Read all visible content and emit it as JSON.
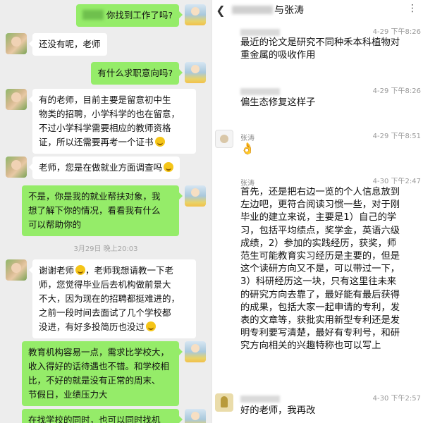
{
  "left_chat": {
    "messages": [
      {
        "from": "me",
        "text": "你找到工作了吗?"
      },
      {
        "from": "other",
        "text": "还没有呢，老师"
      },
      {
        "from": "me",
        "text": "有什么求职意向吗?"
      },
      {
        "from": "other",
        "lines": [
          "有的老师，目前主要是留意初中生",
          "物类的招聘，小学科学的也在留意，",
          "不过小学科学需要相应的教师资格",
          "证，所以还需要再考一个证书"
        ]
      },
      {
        "from": "other",
        "text": "老师，您是在做就业方面调查吗"
      },
      {
        "from": "me",
        "lines": [
          "不是，你是我的就业帮扶对象，我",
          "想了解下你的情况，看看我有什么",
          "可以帮助你的"
        ]
      },
      {
        "from": "other",
        "lines": [
          "谢谢老师",
          "，老师我想请教一下老",
          "师，您觉得毕业后去机构做前景大",
          "不大，因为现在的招聘都挺难进的，",
          "之前一段时间去面试了几个学校都",
          "没进，有好多投简历也没过"
        ]
      },
      {
        "from": "me",
        "lines": [
          "教育机构容易一点，需求比学校大，",
          "收入得好的话待遇也不错。和学校相",
          "比，不好的就是没有正常的周末、",
          "节假日，业绩压力大"
        ]
      },
      {
        "from": "me",
        "text": "在找学校的同时，也可以同时找机"
      }
    ],
    "timestamp": "3月29日 晚上20:03"
  },
  "right_chat": {
    "title_suffix": "与张涛",
    "back_icon": "chevron-left-icon",
    "more_icon": "more-icon",
    "messages": [
      {
        "sender": "",
        "time": "4-29 下午8:26",
        "lines": [
          "最近的论文是研究不同种禾本科植物对",
          "重金属的吸收作用"
        ]
      },
      {
        "sender": "",
        "time": "4-29 下午8:26",
        "lines": [
          "偏生态修复这样子"
        ]
      },
      {
        "sender": "张涛",
        "time": "4-29 下午8:51",
        "emoji": "ok-hand"
      },
      {
        "sender": "张涛",
        "time": "4-30 下午2:47",
        "lines": [
          "首先，还是把右边一览的个人信息放到",
          "左边吧，更符合阅读习惯一些，对于刚",
          "毕业的建立来说，主要是1）自己的学",
          "习，包括平均绩点，奖学金，英语六级",
          "成绩，2）参加的实践经历，获奖，师",
          "范生可能教育实习经历是主要的，但是",
          "这个读研方向又不是，可以带过一下，",
          "3）科研经历这一块，只有这里往未来",
          "的研究方向去靠了，最好能有最后获得",
          "的成果，包括大家一起申请的专利，发",
          "表的文章等，获批实用新型专利还是发",
          "明专利要写清楚，最好有专利号，和研",
          "究方向相关的兴趣特称也可以写上"
        ]
      },
      {
        "sender": "",
        "time": "4-30 下午2:57",
        "lines": [
          "好的老师，我再改"
        ]
      }
    ]
  }
}
